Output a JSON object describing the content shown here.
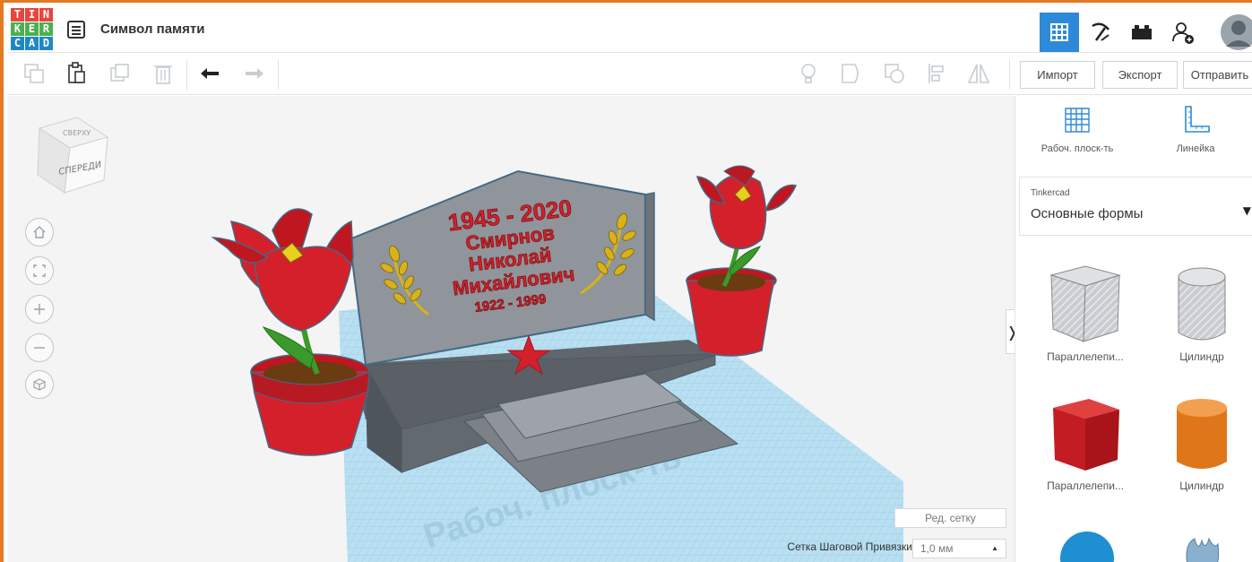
{
  "app": {
    "logo_letters": [
      "T",
      "I",
      "N",
      "K",
      "E",
      "R",
      "C",
      "A",
      "D"
    ],
    "logo_colors": [
      "#e8453c",
      "#e8453c",
      "#e8453c",
      "#4caf50",
      "#4caf50",
      "#4caf50",
      "#1e88c7",
      "#1e88c7",
      "#1e88c7"
    ],
    "title": "Символ памяти"
  },
  "header": {
    "buttons": [
      {
        "name": "3d-design",
        "icon": "grid-icon",
        "active": true
      },
      {
        "name": "blocks",
        "icon": "pickaxe-icon",
        "active": false
      },
      {
        "name": "bricks",
        "icon": "brick-icon",
        "active": false
      },
      {
        "name": "add-user",
        "icon": "add-user-icon",
        "active": false
      },
      {
        "name": "avatar",
        "icon": "avatar-icon",
        "active": false
      }
    ]
  },
  "toolbar": {
    "import_label": "Импорт",
    "export_label": "Экспорт",
    "send_label": "Отправить"
  },
  "viewcube": {
    "top_label": "СВЕРХУ",
    "front_label": "СПЕРЕДИ"
  },
  "workplane": {
    "plane_label": "Рабоч. плоск-ть",
    "grid_edit_label": "Ред. сетку",
    "snap_label": "Сетка Шаговой Привязки",
    "snap_value": "1,0 мм"
  },
  "memorial": {
    "years": "1945 - 2020",
    "surname": "Смирнов",
    "name": "Николай",
    "patronymic": "Михайлович",
    "life": "1922 - 1999"
  },
  "panel": {
    "workplane_label": "Рабоч. плоск-ть",
    "ruler_label": "Линейка",
    "library_source": "Tinkercad",
    "library_name": "Основные формы",
    "shapes": [
      {
        "label": "Параллелепи...",
        "icon": "box-hole-icon"
      },
      {
        "label": "Цилиндр",
        "icon": "cylinder-hole-icon"
      },
      {
        "label": "Параллелепи...",
        "icon": "box-icon"
      },
      {
        "label": "Цилиндр",
        "icon": "cylinder-icon"
      }
    ]
  },
  "colors": {
    "accent": "#2e8ad8",
    "frame": "#e47a24",
    "grid": "#a9d7ee",
    "stone": "#8d9398",
    "flower": "#d4202b",
    "wheat": "#d8b21a"
  }
}
